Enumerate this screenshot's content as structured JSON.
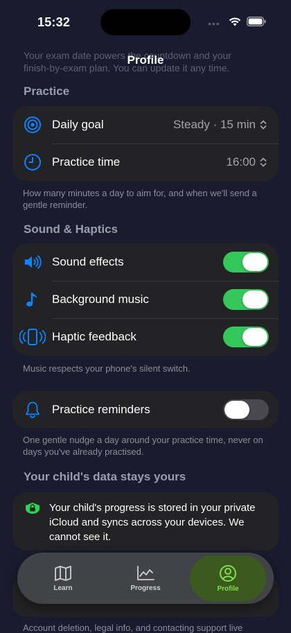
{
  "status": {
    "time": "15:32"
  },
  "ghost": {
    "line1": "Your exam date powers the countdown and your",
    "line2": "finish-by-exam plan. You can update it any time."
  },
  "nav": {
    "title": "Profile"
  },
  "practice": {
    "header": "Practice",
    "daily_goal_label": "Daily goal",
    "daily_goal_value": "Steady · 15 min",
    "practice_time_label": "Practice time",
    "practice_time_value": "16:00",
    "footer": "How many minutes a day to aim for, and when we'll send a gentle reminder."
  },
  "sound": {
    "header": "Sound & Haptics",
    "sound_effects_label": "Sound effects",
    "sound_effects_on": true,
    "background_music_label": "Background music",
    "background_music_on": true,
    "haptic_label": "Haptic feedback",
    "haptic_on": true,
    "footer": "Music respects your phone's silent switch."
  },
  "reminders": {
    "label": "Practice reminders",
    "on": false,
    "footer": "One gentle nudge a day around your practice time, never on days you've already practised."
  },
  "privacy": {
    "header": "Your child's data stays yours",
    "text": "Your child's progress is stored in your private iCloud and syncs across your devices. We cannot see it."
  },
  "bottom": {
    "text": "Account deletion, legal info, and contacting support live"
  },
  "tabs": [
    {
      "label": "Learn",
      "icon": "map-icon"
    },
    {
      "label": "Progress",
      "icon": "chart-icon"
    },
    {
      "label": "Profile",
      "icon": "person-icon",
      "active": true
    }
  ],
  "colors": {
    "accent_blue": "#0a84ff",
    "toggle_green": "#34c759",
    "active_tab_green": "#7ee14a",
    "lock_green": "#30d158"
  }
}
